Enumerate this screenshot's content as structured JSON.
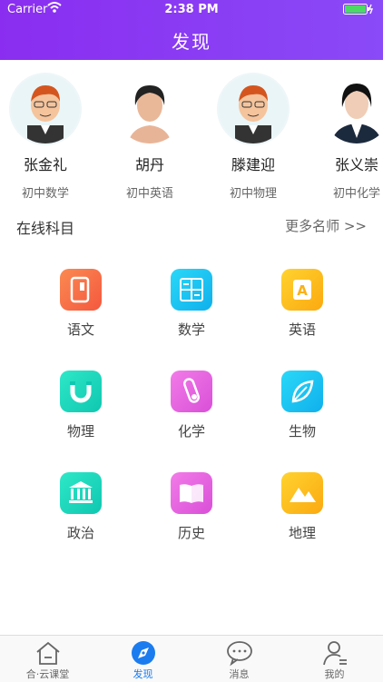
{
  "status": {
    "carrier": "Carrier",
    "time": "2:38 PM"
  },
  "header": {
    "title": "发现"
  },
  "teachers": [
    {
      "name": "张金礼",
      "subject": "初中数学"
    },
    {
      "name": "胡丹",
      "subject": "初中英语"
    },
    {
      "name": "滕建迎",
      "subject": "初中物理"
    },
    {
      "name": "张义崇",
      "subject": "初中化学"
    }
  ],
  "section": {
    "title": "在线科目",
    "more": "更多名师 >>"
  },
  "subjects": [
    {
      "label": "语文",
      "icon": "chinese-book-icon",
      "color": "#f76a4a"
    },
    {
      "label": "数学",
      "icon": "math-calculator-icon",
      "color": "#1cc6f0"
    },
    {
      "label": "英语",
      "icon": "letter-a-icon",
      "color": "#fdbb1a"
    },
    {
      "label": "物理",
      "icon": "magnet-icon",
      "color": "#17d4b8"
    },
    {
      "label": "化学",
      "icon": "test-tube-icon",
      "color": "#e55be0"
    },
    {
      "label": "生物",
      "icon": "leaf-icon",
      "color": "#19c6ef"
    },
    {
      "label": "政治",
      "icon": "government-building-icon",
      "color": "#16c9a4"
    },
    {
      "label": "历史",
      "icon": "open-book-icon",
      "color": "#e55be0"
    },
    {
      "label": "地理",
      "icon": "mountain-icon",
      "color": "#fdbb1a"
    }
  ],
  "tabs": [
    {
      "label": "合·云课堂",
      "icon": "home-icon"
    },
    {
      "label": "发现",
      "icon": "compass-icon",
      "active": true
    },
    {
      "label": "消息",
      "icon": "chat-bubble-icon"
    },
    {
      "label": "我的",
      "icon": "profile-icon"
    }
  ]
}
